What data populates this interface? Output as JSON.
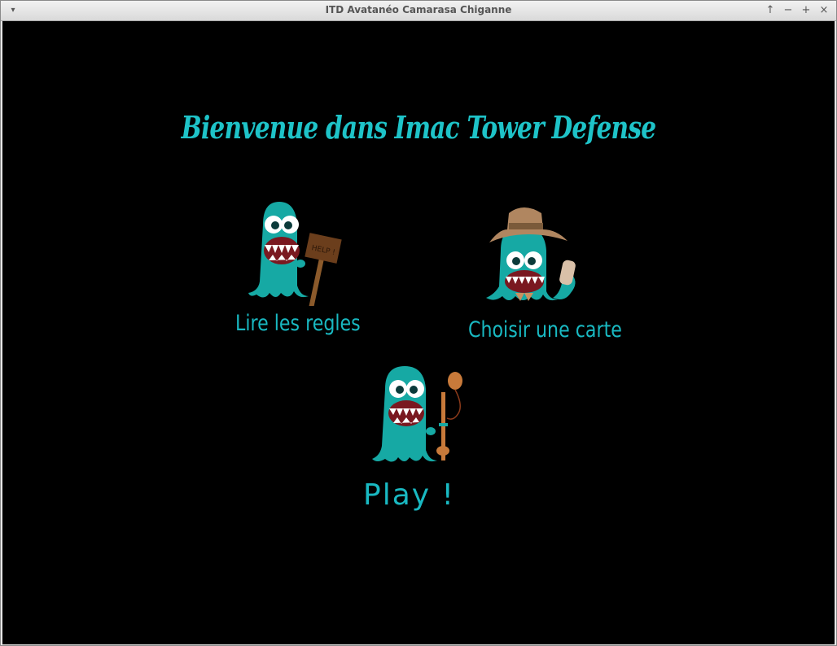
{
  "window": {
    "title": "ITD Avatanéo Camarasa Chiganne",
    "buttons": {
      "menu": "▾",
      "up": "↑",
      "minimize": "−",
      "maximize": "+",
      "close": "×"
    }
  },
  "game": {
    "heading": "Bienvenue dans Imac Tower Defense",
    "menu": {
      "rules_label": "Lire les regles",
      "map_label": "Choisir une carte",
      "play_label": "Play !"
    },
    "sign_text": "HELP !"
  },
  "colors": {
    "background": "#000000",
    "accent_teal": "#19b9c2",
    "monster_body": "#16a9a4",
    "mouth": "#7a1820",
    "wood": "#8b5a2b",
    "hat": "#b08660",
    "balloon": "#c87a3a"
  },
  "icons": [
    "help-sign-monster-icon",
    "explorer-monster-icon",
    "balloon-monster-icon"
  ]
}
